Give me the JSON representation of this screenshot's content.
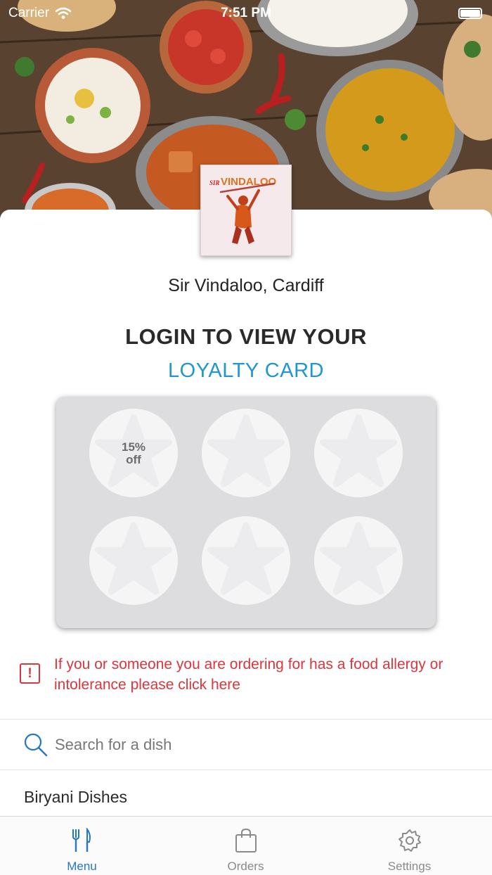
{
  "status_bar": {
    "carrier": "Carrier",
    "time": "7:51 PM"
  },
  "restaurant": {
    "logo_text_small": "SIR",
    "logo_text_large": "VINDALOO",
    "name": "Sir Vindaloo, Cardiff"
  },
  "loyalty": {
    "title": "LOGIN TO VIEW YOUR",
    "subtitle": "LOYALTY CARD",
    "stamps": [
      {
        "label_line1": "15%",
        "label_line2": "off"
      },
      {
        "label_line1": "",
        "label_line2": ""
      },
      {
        "label_line1": "",
        "label_line2": ""
      },
      {
        "label_line1": "",
        "label_line2": ""
      },
      {
        "label_line1": "",
        "label_line2": ""
      },
      {
        "label_line1": "",
        "label_line2": ""
      }
    ]
  },
  "allergy": {
    "icon": "alert-icon",
    "icon_glyph": "!",
    "text": "If you or someone you are ordering for has a food allergy or intolerance please click here",
    "color": "#d9363e"
  },
  "search": {
    "placeholder": "Search for a dish",
    "icon": "search-icon"
  },
  "menu": {
    "first_category": "Biryani Dishes"
  },
  "tab_bar": {
    "tabs": [
      {
        "label": "Menu",
        "icon": "fork-knife-icon",
        "active": true
      },
      {
        "label": "Orders",
        "icon": "shopping-bag-icon",
        "active": false
      },
      {
        "label": "Settings",
        "icon": "gear-icon",
        "active": false
      }
    ],
    "active_color": "#2676c6"
  },
  "colors": {
    "accent": "#2196d3",
    "warning": "#d9363e",
    "card_bg": "#dddde0"
  }
}
